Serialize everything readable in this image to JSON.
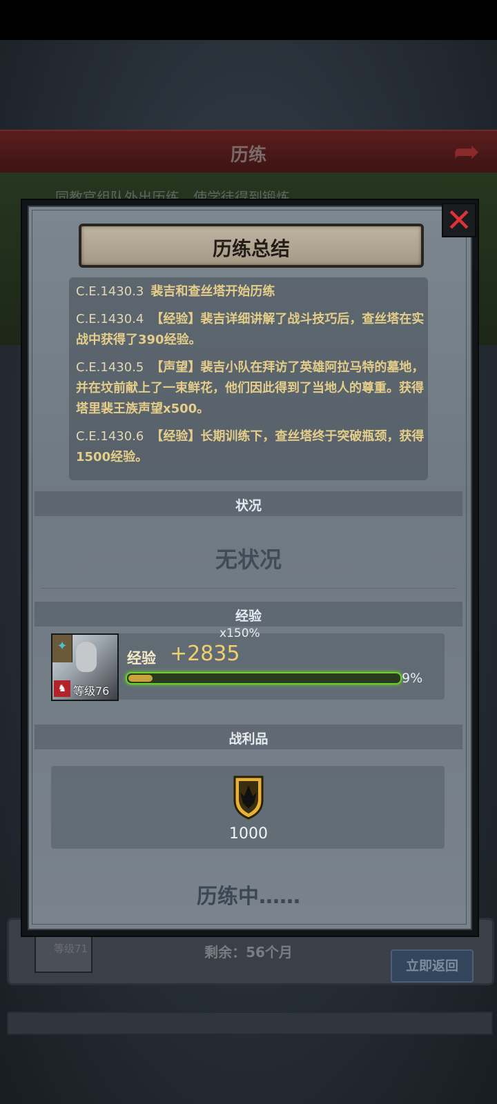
{
  "background": {
    "header_title": "历练",
    "subtitle": "同教官组队外出历练，使学徒得到锻炼",
    "avatar_level": "等级71",
    "remaining": "剩余：56个月",
    "return_button": "立即返回"
  },
  "modal": {
    "title": "历练总结",
    "log": [
      {
        "date": "C.E.1430.3",
        "text": "裴吉和查丝塔开始历练"
      },
      {
        "date": "C.E.1430.4",
        "text": "【经验】裴吉详细讲解了战斗技巧后，查丝塔在实战中获得了390经验。"
      },
      {
        "date": "C.E.1430.5",
        "text": "【声望】裴吉小队在拜访了英雄阿拉马特的墓地，并在坟前献上了一束鲜花，他们因此得到了当地人的尊重。获得塔里裴王族声望x500。"
      },
      {
        "date": "C.E.1430.6",
        "text": "【经验】长期训练下，查丝塔终于突破瓶颈，获得1500经验。"
      }
    ],
    "status_section": "状况",
    "status_value": "无状况",
    "exp_section": "经验",
    "exp": {
      "multiplier": "x150%",
      "label": "经验",
      "gain": "+2835",
      "percent_text": "9%",
      "fill_fraction": 0.09,
      "level": "等级76"
    },
    "loot_section": "战利品",
    "loot": {
      "icon": "guild-shield-icon",
      "amount": "1000"
    },
    "progress_status": "历练中……"
  },
  "colors": {
    "accent_gold": "#f0cf6c",
    "close_red": "#e03236",
    "exp_bar_green": "#6bd02b"
  }
}
